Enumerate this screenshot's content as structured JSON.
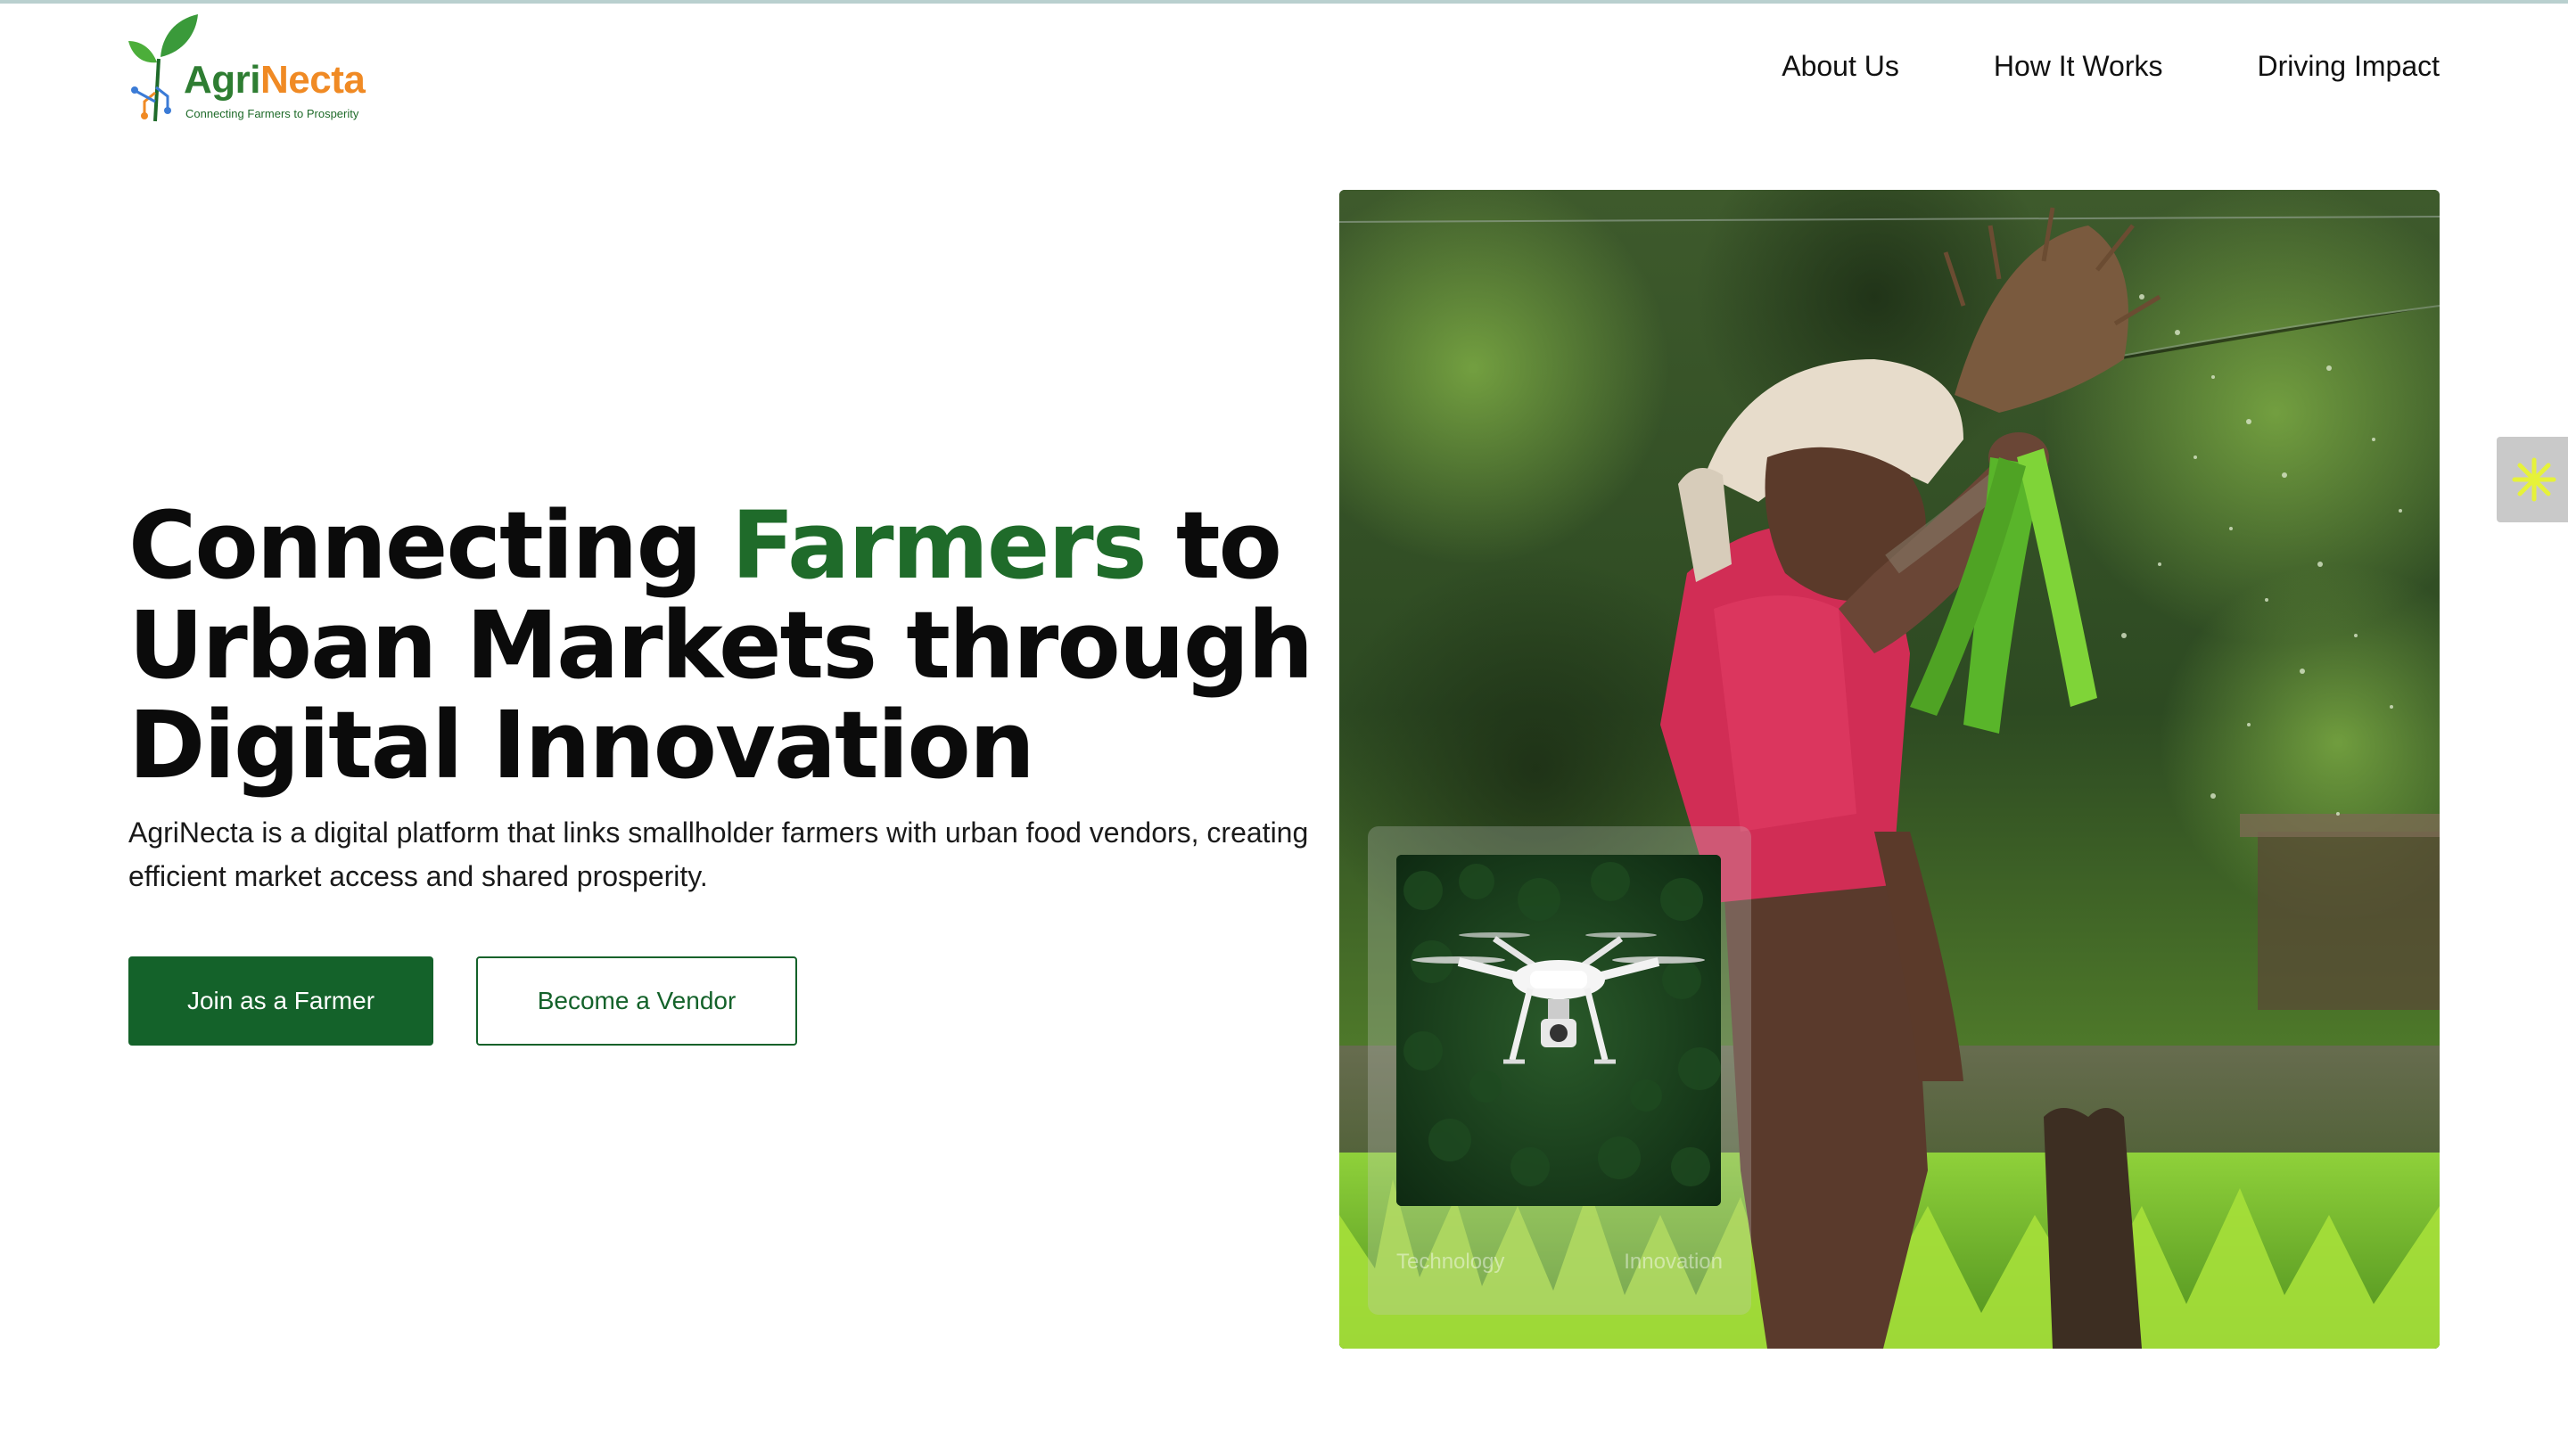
{
  "brand": {
    "name_part1": "Agri",
    "name_part2": "Necta",
    "tagline": "Connecting Farmers to Prosperity",
    "colors": {
      "green": "#2e7d32",
      "orange": "#f08a24"
    }
  },
  "nav": {
    "items": [
      {
        "label": "About Us"
      },
      {
        "label": "How It Works"
      },
      {
        "label": "Driving Impact"
      }
    ]
  },
  "hero": {
    "title_part1": "Connecting ",
    "title_highlight": "Farmers",
    "title_part2": " to Urban Markets through Digital Innovation",
    "description": "AgriNecta is a digital platform that links smallholder farmers with urban food vendors, creating efficient market access and shared prosperity.",
    "primary_button": "Join as a Farmer",
    "secondary_button": "Become a Vendor",
    "accent_color": "#1f6b2a"
  },
  "hero_image": {
    "card": {
      "label_left": "Technology",
      "label_right": "Innovation"
    }
  },
  "side_widget": {
    "icon": "asterisk-icon",
    "color": "#e6f23a"
  }
}
